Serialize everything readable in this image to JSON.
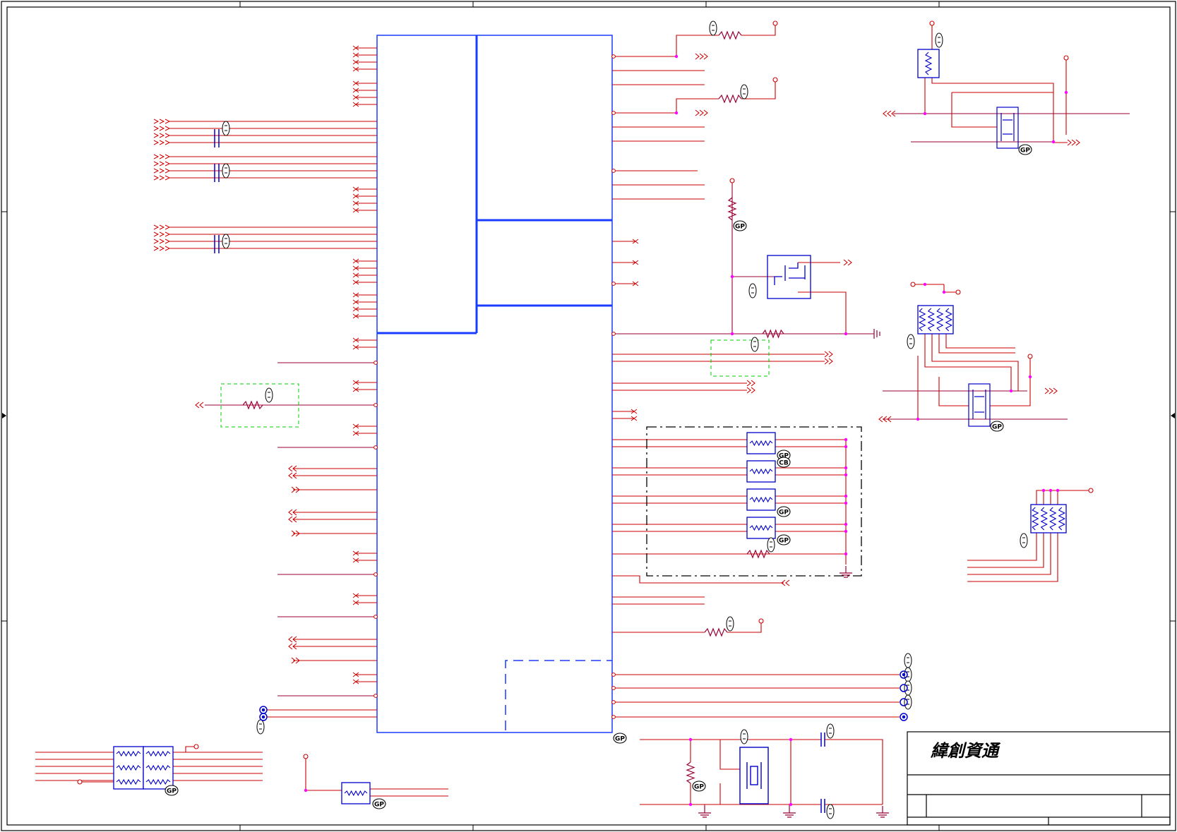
{
  "title_block": {
    "company": "緯創資通"
  },
  "badges": {
    "gp": "GP",
    "cb": "CB"
  },
  "colors": {
    "wire": "#cc0000",
    "wire_dark": "#990033",
    "component": "#0000cc",
    "junction": "#ff00ff",
    "frame": "#000000",
    "dashed_group": "#00cc00"
  }
}
